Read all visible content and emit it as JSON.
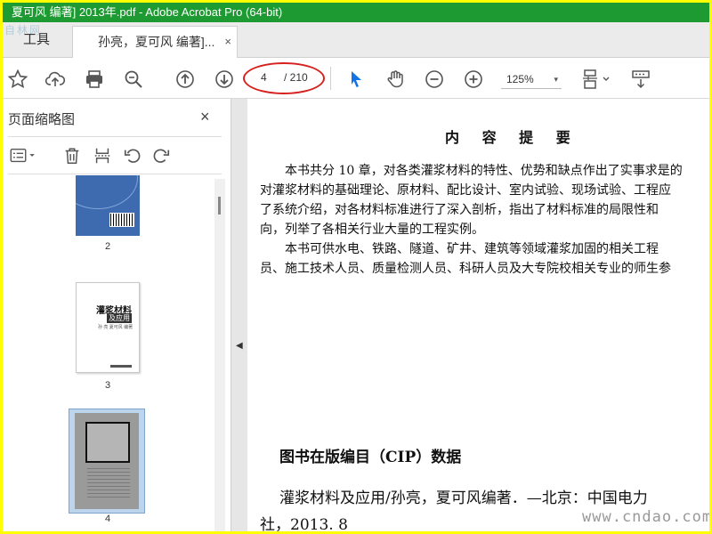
{
  "window": {
    "title": "夏可风 编著] 2013年.pdf - Adobe Acrobat Pro (64-bit)"
  },
  "tabs": {
    "tools_label": "工具",
    "document_label": "孙亮，夏可风 编著]...",
    "close_glyph": "×"
  },
  "toolbar": {
    "current_page": "4",
    "total_pages": "/ 210",
    "zoom_level": "125%",
    "zoom_caret": "▾",
    "highlight_color": "#d6211e",
    "accent_color": "#1473e6"
  },
  "sidebar": {
    "title": "页面缩略图",
    "close_glyph": "×",
    "thumbnails": [
      {
        "label": "2"
      },
      {
        "label": "3",
        "cover_title": "灌浆材料",
        "cover_subtitle": "及应用",
        "cover_authors": "孙 亮 夏可风 编著"
      },
      {
        "label": "4"
      }
    ]
  },
  "splitter": {
    "arrow_glyph": "◀"
  },
  "document": {
    "heading": "内 容 提 要",
    "paragraphs": [
      "本书共分 10 章，对各类灌浆材料的特性、优势和缺点作出了实事求是的",
      "对灌浆材料的基础理论、原材料、配比设计、室内试验、现场试验、工程应",
      "了系统介绍，对各材料标准进行了深入剖析，指出了材料标准的局限性和",
      "向，列举了各相关行业大量的工程实例。",
      "本书可供水电、铁路、隧道、矿井、建筑等领域灌浆加固的相关工程",
      "员、施工技术人员、质量检测人员、科研人员及大专院校相关专业的师生参"
    ],
    "cip_heading": "图书在版编目（CIP）数据",
    "cip_lines": [
      "灌浆材料及应用/孙亮，夏可风编著．—北京：中国电力",
      "社，2013. 8"
    ]
  },
  "watermarks": {
    "top_logo": "自林网",
    "site": "www.cndao.com"
  },
  "icons": [
    "star-icon",
    "cloud-upload-icon",
    "print-icon",
    "zoom-search-icon",
    "arrow-up-icon",
    "arrow-down-icon",
    "select-arrow-icon",
    "hand-icon",
    "zoom-out-icon",
    "zoom-in-icon",
    "page-fit-icon",
    "scroll-mode-icon",
    "options-icon",
    "delete-icon",
    "insert-page-icon",
    "rotate-ccw-icon",
    "rotate-cw-icon"
  ]
}
